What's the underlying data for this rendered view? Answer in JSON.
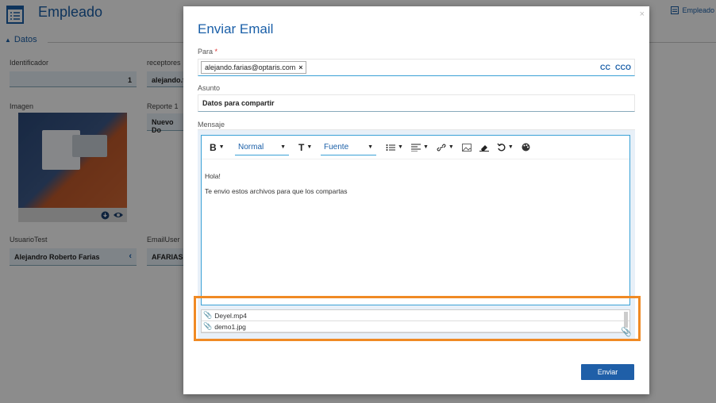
{
  "background": {
    "page_title": "Empleado",
    "top_right_link": "Empleado",
    "section": "Datos",
    "fields": [
      {
        "label": "Identificador",
        "value": "1"
      },
      {
        "label": "receptores",
        "value": "alejando.f"
      },
      {
        "label": "Imagen",
        "value": ""
      },
      {
        "label": "Reporte 1",
        "value": "Nuevo Do"
      },
      {
        "label": "UsuarioTest",
        "value": "Alejandro Roberto Farias"
      },
      {
        "label": "EmailUser",
        "value": "AFARIAS.S"
      }
    ]
  },
  "modal": {
    "title": "Enviar Email",
    "close": "×",
    "para_label": "Para",
    "required_mark": "*",
    "recipient": "alejando.farias@optaris.com",
    "chip_remove": "×",
    "cc": "CC",
    "cco": "CCO",
    "asunto_label": "Asunto",
    "asunto_value": "Datos para compartir",
    "mensaje_label": "Mensaje",
    "toolbar": {
      "bold": "B",
      "style_select": "Normal",
      "text_size": "T",
      "font_select": "Fuente"
    },
    "body_lines": [
      "Hola!",
      "Te envio estos archivos para que los compartas"
    ],
    "attachments": [
      "Deyel.mp4",
      "demo1.jpg"
    ],
    "send_label": "Enviar"
  },
  "colors": {
    "accent": "#1a5fa8",
    "focus": "#3aa1d6",
    "highlight": "#f08a24",
    "send_button": "#1f5fa8"
  }
}
